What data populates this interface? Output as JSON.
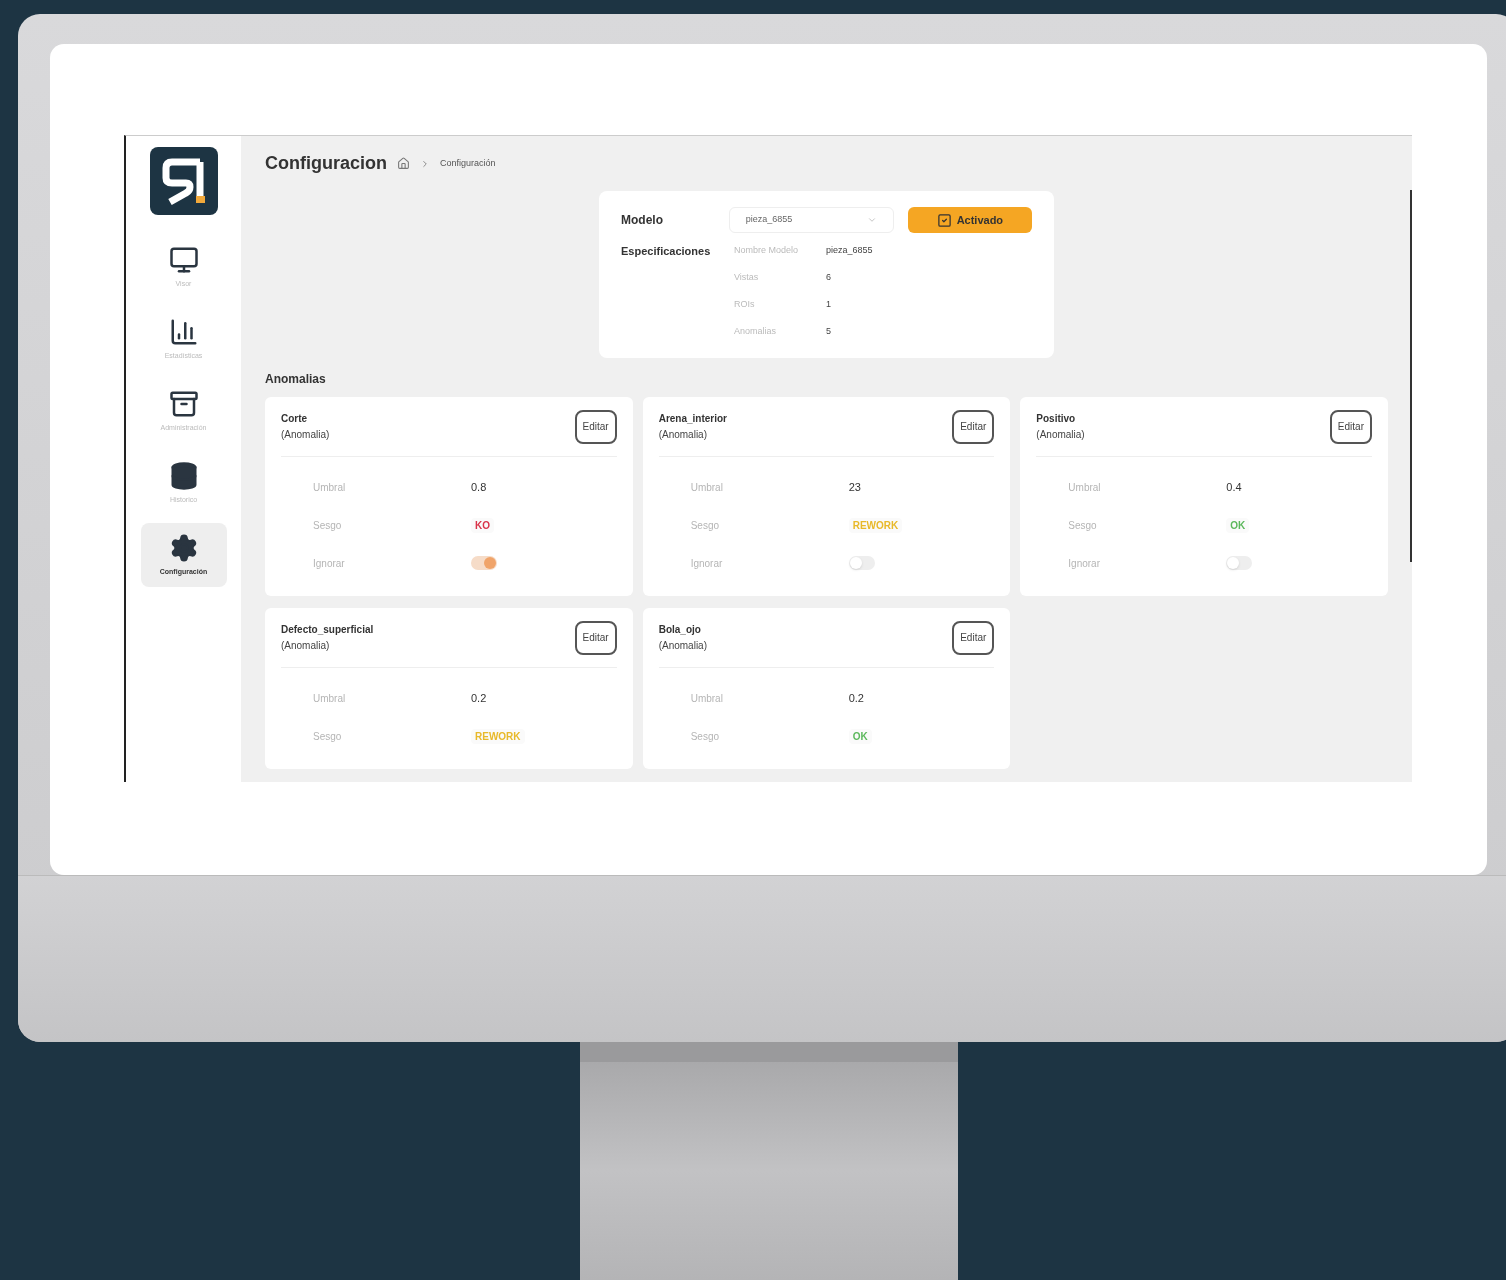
{
  "sidebar": {
    "items": [
      {
        "label": "Visor",
        "selected": false
      },
      {
        "label": "Estadísticas",
        "selected": false
      },
      {
        "label": "Administración",
        "selected": false
      },
      {
        "label": "Historico",
        "selected": false
      },
      {
        "label": "Configuración",
        "selected": true
      }
    ]
  },
  "header": {
    "title": "Configuracion",
    "breadcrumb": "Configuración"
  },
  "model_card": {
    "model_label": "Modelo",
    "model_value": "pieza_6855",
    "activated": {
      "label": "Activado",
      "checked": true
    },
    "specs_label": "Especificaciones",
    "specs": [
      {
        "label": "Nombre Modelo",
        "value": "pieza_6855"
      },
      {
        "label": "Vistas",
        "value": "6"
      },
      {
        "label": "ROIs",
        "value": "1"
      },
      {
        "label": "Anomalias",
        "value": "5"
      }
    ]
  },
  "anomalies": {
    "title": "Anomalias",
    "cards": [
      {
        "name": "Corte",
        "type": "(Anomalia)",
        "button": "Editar",
        "fields": [
          {
            "kind": "text",
            "label": "Umbral",
            "value": "0.8"
          },
          {
            "kind": "tag",
            "label": "Sesgo",
            "value": "KO",
            "color": "#d9344a"
          },
          {
            "kind": "switch",
            "label": "Ignorar",
            "on": true
          }
        ]
      },
      {
        "name": "Arena_interior",
        "type": "(Anomalia)",
        "button": "Editar",
        "fields": [
          {
            "kind": "text",
            "label": "Umbral",
            "value": "23"
          },
          {
            "kind": "tag",
            "label": "Sesgo",
            "value": "REWORK",
            "color": "#e8b92a"
          },
          {
            "kind": "switch",
            "label": "Ignorar",
            "on": false
          }
        ]
      },
      {
        "name": "Positivo",
        "type": "(Anomalia)",
        "button": "Editar",
        "fields": [
          {
            "kind": "text",
            "label": "Umbral",
            "value": "0.4"
          },
          {
            "kind": "tag",
            "label": "Sesgo",
            "value": "OK",
            "color": "#5cb85c"
          },
          {
            "kind": "switch",
            "label": "Ignorar",
            "on": false
          }
        ]
      },
      {
        "name": "Defecto_superficial",
        "type": "(Anomalia)",
        "button": "Editar",
        "fields": [
          {
            "kind": "text",
            "label": "Umbral",
            "value": "0.2"
          },
          {
            "kind": "tag",
            "label": "Sesgo",
            "value": "REWORK",
            "color": "#e8b92a"
          }
        ]
      },
      {
        "name": "Bola_ojo",
        "type": "(Anomalia)",
        "button": "Editar",
        "fields": [
          {
            "kind": "text",
            "label": "Umbral",
            "value": "0.2"
          },
          {
            "kind": "tag",
            "label": "Sesgo",
            "value": "OK",
            "color": "#5cb85c"
          }
        ]
      }
    ]
  }
}
